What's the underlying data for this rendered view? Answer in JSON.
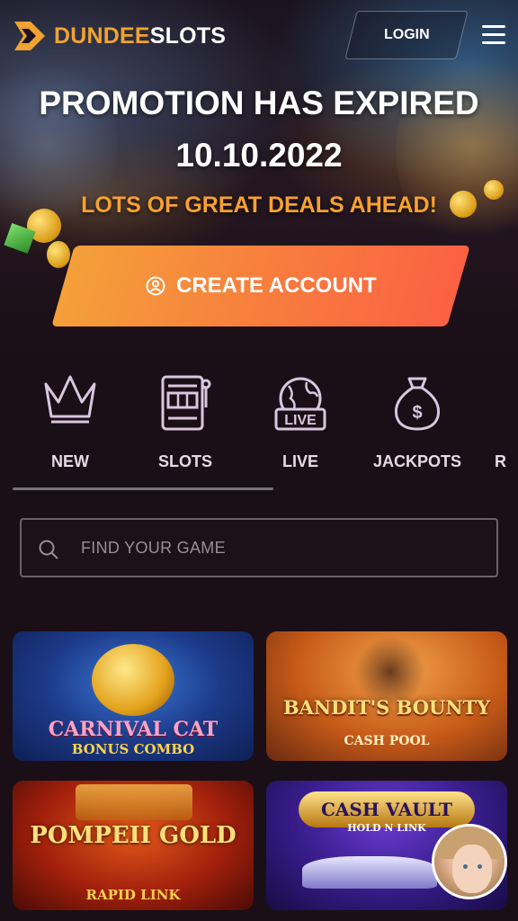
{
  "header": {
    "logo_brand_a": "DUNDEE",
    "logo_brand_b": "SLOTS",
    "login_label": "LOGIN"
  },
  "hero": {
    "title": "PROMOTION HAS EXPIRED",
    "date": "10.10.2022",
    "subtitle": "LOTS OF GREAT DEALS AHEAD!",
    "cta_label": "CREATE ACCOUNT"
  },
  "categories": [
    {
      "label": "NEW",
      "icon": "crown-icon"
    },
    {
      "label": "SLOTS",
      "icon": "slot-machine-icon"
    },
    {
      "label": "LIVE",
      "icon": "live-globe-icon"
    },
    {
      "label": "JACKPOTS",
      "icon": "money-bag-icon"
    },
    {
      "label": "R",
      "icon": ""
    }
  ],
  "search": {
    "placeholder": "FIND YOUR GAME"
  },
  "games": [
    {
      "title": "CARNIVAL CAT",
      "subtitle": "BONUS COMBO"
    },
    {
      "title": "BANDIT'S BOUNTY",
      "subtitle": "CASH POOL"
    },
    {
      "title": "POMPEII GOLD",
      "subtitle": "RAPID LINK"
    },
    {
      "title": "CASH VAULT",
      "subtitle": "HOLD N LINK"
    }
  ],
  "colors": {
    "brand_orange": "#f0a330",
    "cta_start": "#f4a03a",
    "cta_end": "#fb6143",
    "background": "#1a0f16"
  }
}
